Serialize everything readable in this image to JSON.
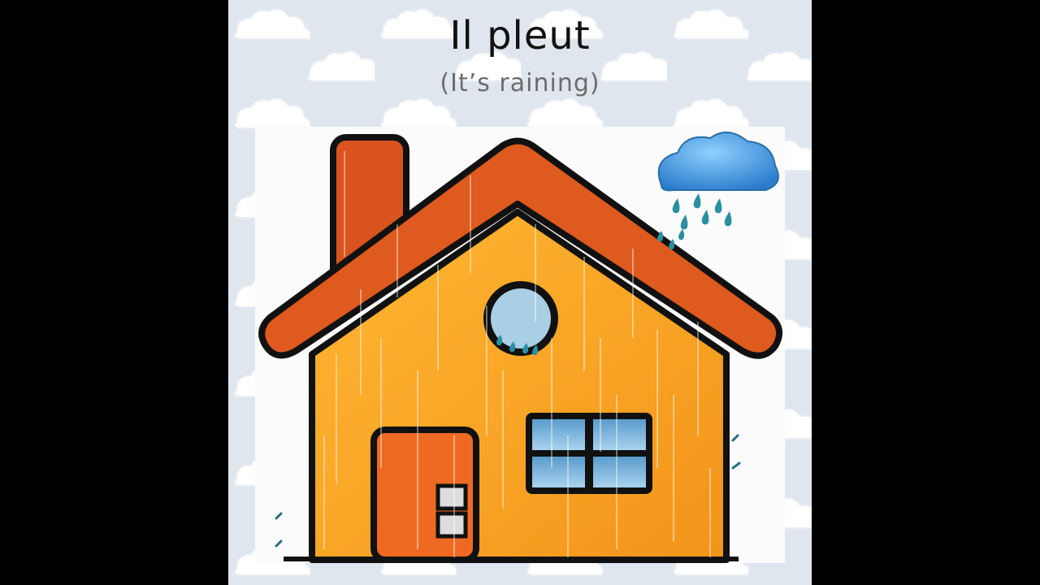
{
  "slide": {
    "title": "Il pleut",
    "subtitle": "(It’s raining)"
  },
  "colors": {
    "letterbox": "#000000",
    "sky_background": "#dfe6ee",
    "cloud_pattern": "#ffffff",
    "house_wall": "#f8a31e",
    "roof": "#de5a1f",
    "chimney": "#d9531f",
    "door": "#ee6a23",
    "window_glass": "#7fb0d6",
    "outline": "#111111",
    "rain_cloud": "#3a8fd6",
    "raindrop": "#2a8fa0"
  },
  "icons": [
    "house-icon",
    "rain-cloud-icon",
    "raindrop-icon"
  ]
}
